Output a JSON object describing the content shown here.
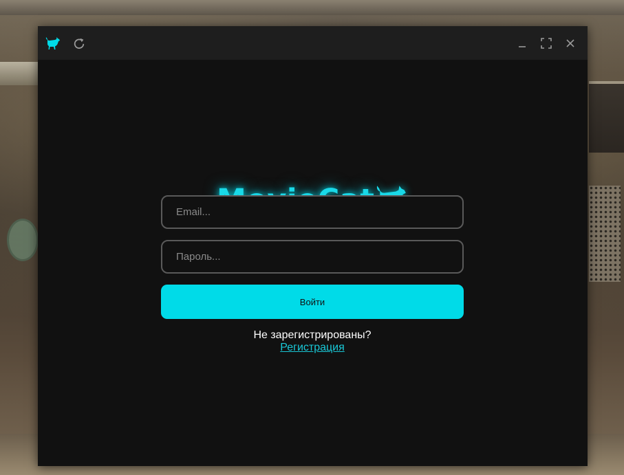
{
  "window": {
    "app_icon": "cat-icon",
    "refresh_icon": "refresh-icon",
    "minimize_icon": "minimize-icon",
    "maximize_icon": "maximize-icon",
    "close_icon": "close-icon"
  },
  "login": {
    "logo_text": "MovieCat",
    "logo_icon": "cat-icon",
    "email_placeholder": "Email...",
    "password_placeholder": "Пароль...",
    "submit_label": "Войти",
    "register_prompt": "Не зарегистрированы?",
    "register_link": "Регистрация"
  },
  "colors": {
    "accent": "#00dbe8",
    "window_bg": "#111111",
    "titlebar_bg": "#1e1e1e",
    "field_border": "#5a5a5a"
  }
}
